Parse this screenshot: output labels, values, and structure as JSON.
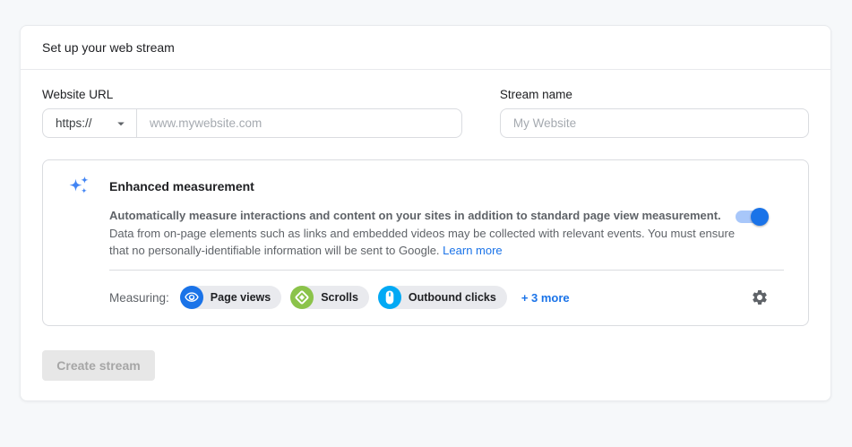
{
  "dialog": {
    "title": "Set up your web stream"
  },
  "form": {
    "website_url": {
      "label": "Website URL",
      "protocol_selected": "https://",
      "placeholder": "www.mywebsite.com",
      "value": ""
    },
    "stream_name": {
      "label": "Stream name",
      "placeholder": "My Website",
      "value": ""
    }
  },
  "enhanced_measurement": {
    "title": "Enhanced measurement",
    "summary": "Automatically measure interactions and content on your sites in addition to standard page view measurement.",
    "details": "Data from on-page elements such as links and embedded videos may be collected with relevant events. You must ensure that no personally-identifiable information will be sent to Google.",
    "learn_more_label": "Learn more",
    "toggle_state": "on",
    "measuring_label": "Measuring:",
    "chips": [
      {
        "label": "Page views",
        "icon": "eye-icon",
        "color": "#1a73e8"
      },
      {
        "label": "Scrolls",
        "icon": "diamond-icon",
        "color": "#8bc34a"
      },
      {
        "label": "Outbound clicks",
        "icon": "mouse-icon",
        "color": "#03a9f4"
      }
    ],
    "more_link_label": "+ 3 more"
  },
  "actions": {
    "create_stream_label": "Create stream"
  },
  "colors": {
    "accent_blue": "#1a73e8",
    "sparkle_blue": "#4285f4",
    "toggle_track": "#a8c7fa",
    "chip_background": "#e9eaee",
    "page_background": "#f6f8fa",
    "muted_text": "#5f6368"
  }
}
